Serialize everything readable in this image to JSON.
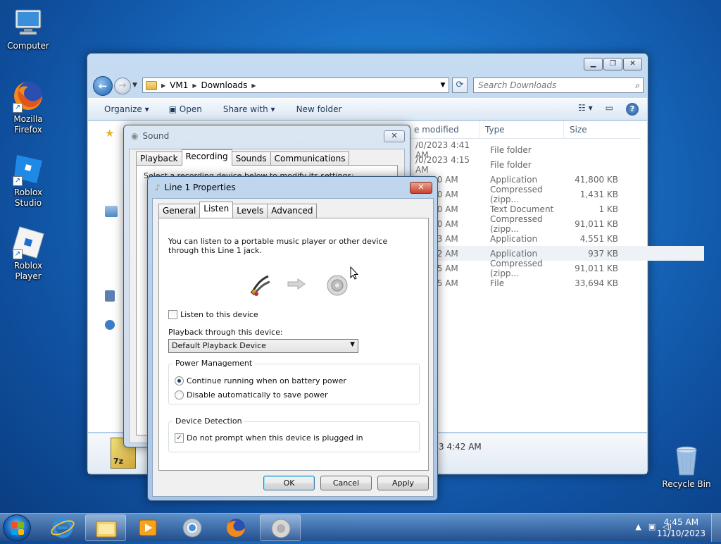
{
  "desktop": {
    "icons": [
      {
        "label": "Computer"
      },
      {
        "label": "Mozilla Firefox"
      },
      {
        "label": "Roblox Studio"
      },
      {
        "label": "Roblox Player"
      },
      {
        "label": "Recycle Bin"
      }
    ]
  },
  "explorer": {
    "address": {
      "parts": [
        "VM1",
        "Downloads"
      ]
    },
    "search_placeholder": "Search Downloads",
    "toolbar": {
      "organize": "Organize ▾",
      "open": "Open",
      "share_with": "Share with ▾",
      "new_folder": "New folder"
    },
    "columns": {
      "date": "e modified",
      "type": "Type",
      "size": "Size"
    },
    "rows": [
      {
        "date": "/0/2023 4:41 AM",
        "type": "File folder",
        "size": ""
      },
      {
        "date": "/0/2023 4:15 AM",
        "type": "File folder",
        "size": ""
      },
      {
        "date": "3 4:30 AM",
        "type": "Application",
        "size": "41,800 KB"
      },
      {
        "date": "3 4:40 AM",
        "type": "Compressed (zipp...",
        "size": "1,431 KB"
      },
      {
        "date": "3 4:40 AM",
        "type": "Text Document",
        "size": "1 KB"
      },
      {
        "date": "3 4:40 AM",
        "type": "Compressed (zipp...",
        "size": "91,011 KB"
      },
      {
        "date": "3 4:33 AM",
        "type": "Application",
        "size": "4,551 KB"
      },
      {
        "date": "3 4:42 AM",
        "type": "Application",
        "size": "937 KB"
      },
      {
        "date": "3 4:15 AM",
        "type": "Compressed (zipp...",
        "size": "91,011 KB"
      },
      {
        "date": "3 4:15 AM",
        "type": "File",
        "size": "33,694 KB"
      }
    ],
    "details_text": "3 4:42 AM",
    "zip_label": "7z"
  },
  "sound": {
    "title": "Sound",
    "tabs": [
      "Playback",
      "Recording",
      "Sounds",
      "Communications"
    ],
    "active_tab": "Recording",
    "clipped_text": "Select a recording device below to modify its settings:"
  },
  "props": {
    "title": "Line 1 Properties",
    "tabs": [
      "General",
      "Listen",
      "Levels",
      "Advanced"
    ],
    "active_tab": "Listen",
    "description": "You can listen to a portable music player or other device through this Line 1 jack.",
    "listen_checkbox": {
      "label": "Listen to this device",
      "checked": false
    },
    "playback_label": "Playback through this device:",
    "playback_value": "Default Playback Device",
    "power_group": "Power Management",
    "power_options": [
      {
        "label": "Continue running when on battery power",
        "selected": true
      },
      {
        "label": "Disable automatically to save power",
        "selected": false
      }
    ],
    "detection_group": "Device Detection",
    "detection_checkbox": {
      "label": "Do not prompt when this device is plugged in",
      "checked": true
    },
    "buttons": {
      "ok": "OK",
      "cancel": "Cancel",
      "apply": "Apply"
    }
  },
  "taskbar": {
    "time": "4:45 AM",
    "date": "11/10/2023"
  }
}
